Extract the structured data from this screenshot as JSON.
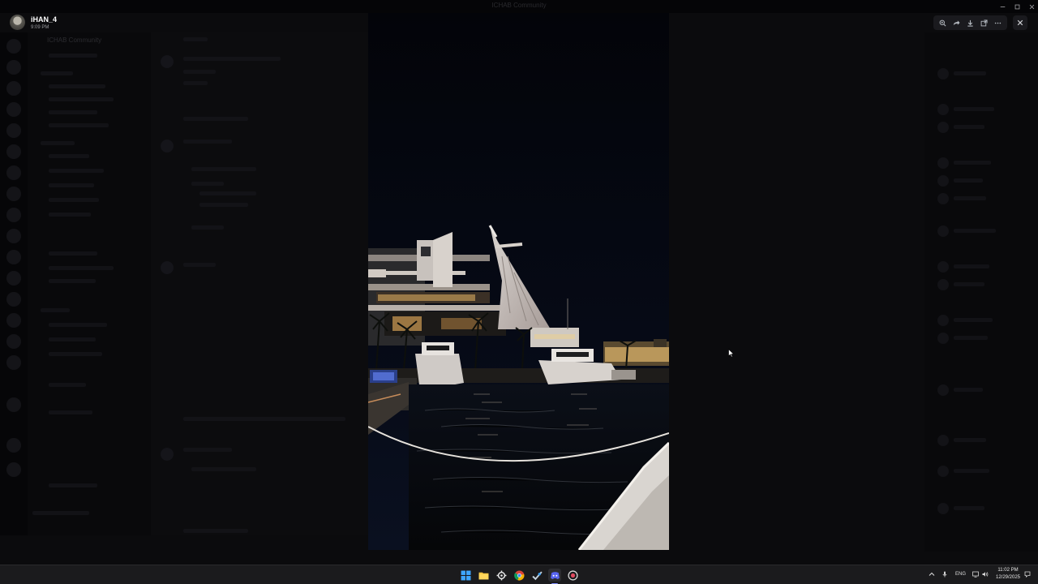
{
  "window": {
    "title": "ICHAB Community"
  },
  "author": {
    "name": "iHAN_4",
    "time": "9:09 PM"
  },
  "background": {
    "server_name": "ICHAB Community",
    "channel_name": "#welcome"
  },
  "viewer": {
    "toolbar": [
      {
        "name": "zoom-icon",
        "label": "Zoom"
      },
      {
        "name": "forward-icon",
        "label": "Forward"
      },
      {
        "name": "download-icon",
        "label": "Download"
      },
      {
        "name": "open-external-icon",
        "label": "Open in Browser"
      },
      {
        "name": "more-icon",
        "label": "More"
      }
    ],
    "close_label": "Close"
  },
  "taskbar": {
    "apps": [
      {
        "name": "start-icon",
        "color": "#3ea6ff"
      },
      {
        "name": "file-explorer-icon",
        "color": "#f4c542"
      },
      {
        "name": "settings-icon",
        "color": "#e6e6e6"
      },
      {
        "name": "chrome-icon",
        "color": "#4caf50"
      },
      {
        "name": "steam-icon",
        "color": "#c7d5e0"
      },
      {
        "name": "discord-icon",
        "color": "#5865f2"
      },
      {
        "name": "recorder-icon",
        "color": "#e04a5f"
      }
    ],
    "tray": {
      "language": "ENG",
      "time": "11:02 PM",
      "date": "12/29/2025"
    }
  },
  "colors": {
    "viewer_backdrop": "#000000",
    "taskbar": "#1b1b1d",
    "night_sky": "#05070d",
    "warm_light": "#f3c77a"
  }
}
